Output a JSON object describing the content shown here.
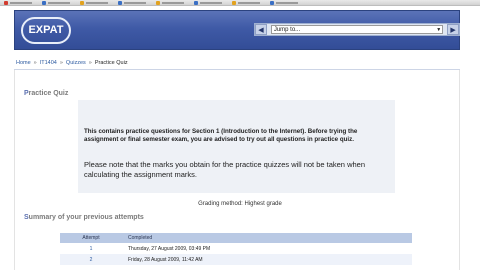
{
  "header": {
    "logo_text": "EXPAT",
    "jump_placeholder": "Jump to..."
  },
  "breadcrumb": {
    "items": [
      "Home",
      "IT1404",
      "Quizzes"
    ],
    "current": "Practice Quiz"
  },
  "quiz": {
    "title_first": "P",
    "title_rest": "ractice Quiz",
    "intro_text": "This contains practice questions for Section 1 (Introduction to the Internet). Before trying the assignment or final semester exam, you are advised to try out all questions in practice quiz.",
    "note_text": "Please note that the marks you obtain for the practice quizzes will not be taken when calculating the assignment marks.",
    "grading_method": "Grading method: Highest grade"
  },
  "summary": {
    "title_first": "S",
    "title_rest": "ummary of your previous attempts",
    "columns": [
      "Attempt",
      "Completed"
    ],
    "rows": [
      {
        "attempt": "1",
        "completed": "Thursday, 27 August 2009, 03:49 PM"
      },
      {
        "attempt": "2",
        "completed": "Friday, 28 August 2009, 11:42 AM"
      }
    ]
  },
  "colors": {
    "header_bg": "#3f5aa6",
    "link": "#2c5aa0",
    "table_header": "#b9c9e4"
  }
}
